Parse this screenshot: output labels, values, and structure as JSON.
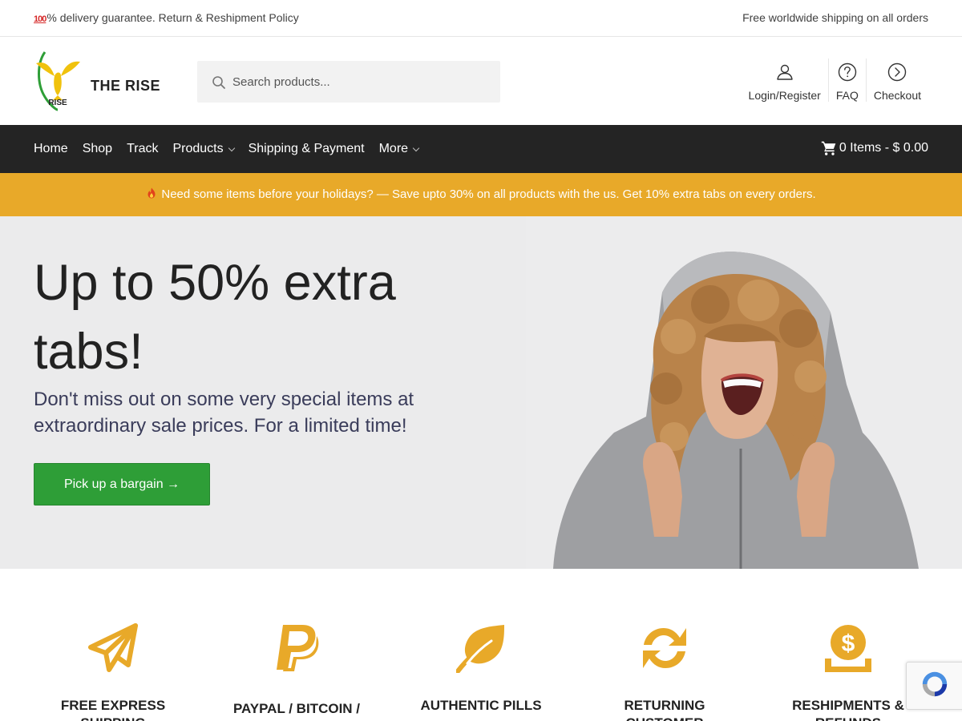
{
  "topbar": {
    "hundred": "100",
    "left_text": "% delivery guarantee. Return & Reshipment Policy",
    "right_text": "Free worldwide shipping on all orders"
  },
  "header": {
    "brand": "THE RISE",
    "logo_text": "RISE",
    "search_placeholder": "Search products...",
    "links": [
      {
        "label": "Login/Register",
        "icon": "user-icon"
      },
      {
        "label": "FAQ",
        "icon": "question-icon"
      },
      {
        "label": "Checkout",
        "icon": "arrow-right-circle-icon"
      }
    ]
  },
  "nav": {
    "items": [
      {
        "label": "Home",
        "dropdown": false
      },
      {
        "label": "Shop",
        "dropdown": false
      },
      {
        "label": "Track",
        "dropdown": false
      },
      {
        "label": "Products",
        "dropdown": true
      },
      {
        "label": "Shipping & Payment",
        "dropdown": false
      },
      {
        "label": "More",
        "dropdown": true
      }
    ],
    "cart_label": "0 Items - $ 0.00"
  },
  "promo": {
    "text": "Need some items before your holidays? — Save upto 30% on all products with the us. Get 10% extra tabs on every orders."
  },
  "hero": {
    "title": "Up to 50% extra tabs!",
    "subtitle": "Don't miss out on some very special items at extraordinary sale prices. For a limited time!",
    "cta_label": "Pick up a bargain →"
  },
  "features": [
    {
      "title": "FREE EXPRESS SHIPPING",
      "icon": "paper-plane-icon"
    },
    {
      "title": "PAYPAL / BITCOIN /",
      "icon": "paypal-icon"
    },
    {
      "title": "AUTHENTIC PILLS",
      "icon": "leaf-icon"
    },
    {
      "title": "RETURNING CUSTOMER",
      "icon": "refresh-icon"
    },
    {
      "title": "RESHIPMENTS & REFUNDS",
      "icon": "money-bag-icon"
    }
  ],
  "colors": {
    "accent": "#e8a929",
    "nav_bg": "#242424",
    "cta_green": "#2e9e37"
  }
}
